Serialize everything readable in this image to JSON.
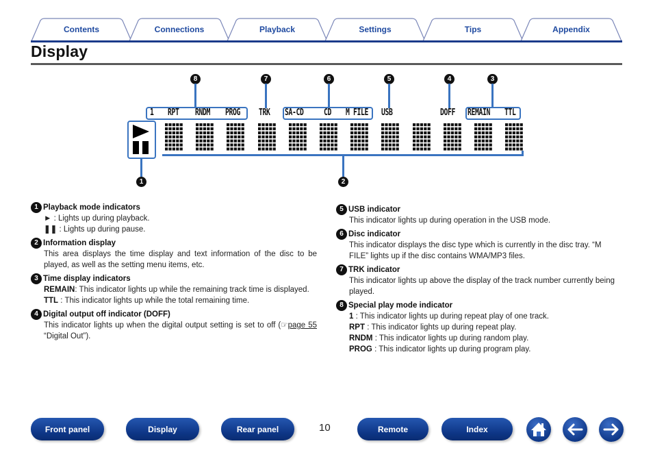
{
  "tabs": [
    {
      "label": "Contents"
    },
    {
      "label": "Connections"
    },
    {
      "label": "Playback"
    },
    {
      "label": "Settings"
    },
    {
      "label": "Tips"
    },
    {
      "label": "Appendix"
    }
  ],
  "page": {
    "title": "Display",
    "number": "10"
  },
  "diagram": {
    "callouts": [
      "1",
      "2",
      "3",
      "4",
      "5",
      "6",
      "7",
      "8"
    ],
    "indicators": {
      "one": "1",
      "rpt": "RPT",
      "rndm": "RNDM",
      "prog": "PROG",
      "trk": "TRK",
      "sacd": "SA-CD",
      "cd": "CD",
      "mfile": "M FILE",
      "usb": "USB",
      "doff": "DOFF",
      "remain": "REMAIN",
      "ttl": "TTL"
    },
    "playback_icons": [
      "play-icon",
      "pause-icon"
    ],
    "dot_matrix_characters": 12,
    "accent_color": "#3a74c0"
  },
  "descriptions": {
    "playback_mode": {
      "num": "1",
      "title": "Playback mode indicators",
      "play_line": " : Lights up during playback.",
      "pause_line": " : Lights up during pause."
    },
    "info_display": {
      "num": "2",
      "title": "Information display",
      "text": "This area displays the time display and text information of the disc to be played, as well as the setting menu items, etc."
    },
    "time_display": {
      "num": "3",
      "title": "Time display indicators",
      "remain_key": "REMAIN",
      "remain_text": " : This indicator lights up while the remaining track time is displayed.",
      "ttl_key": "TTL",
      "ttl_text": " : This indicator lights up while the total remaining time."
    },
    "doff": {
      "num": "4",
      "title": "Digital output off indicator (DOFF)",
      "text": "This indicator lights up when the digital output setting is set to off (",
      "link": "page 55",
      "text_after": " “Digital Out”)."
    },
    "usb": {
      "num": "5",
      "title": "USB indicator",
      "text": "This indicator lights up during operation in the USB mode."
    },
    "disc": {
      "num": "6",
      "title": "Disc indicator",
      "text": "This indicator displays the disc type which is currently in the disc tray. “M FILE” lights up if the disc contains WMA/MP3 files."
    },
    "trk": {
      "num": "7",
      "title": "TRK indicator",
      "text": "This indicator lights up above the display of the track number currently being played."
    },
    "special": {
      "num": "8",
      "title": "Special play mode indicator",
      "rows": [
        {
          "key": "1",
          "text": " : This indicator lights up during repeat play of one track."
        },
        {
          "key": "RPT",
          "text": " : This indicator lights up during repeat play."
        },
        {
          "key": "RNDM",
          "text": " : This indicator lights up during random play."
        },
        {
          "key": "PROG",
          "text": " : This indicator lights up during program play."
        }
      ]
    }
  },
  "bottom_nav": {
    "front_panel": "Front panel",
    "display": "Display",
    "rear_panel": "Rear panel",
    "remote": "Remote",
    "index": "Index",
    "home_icon": "home-icon",
    "back_icon": "arrow-left-icon",
    "forward_icon": "arrow-right-icon"
  }
}
